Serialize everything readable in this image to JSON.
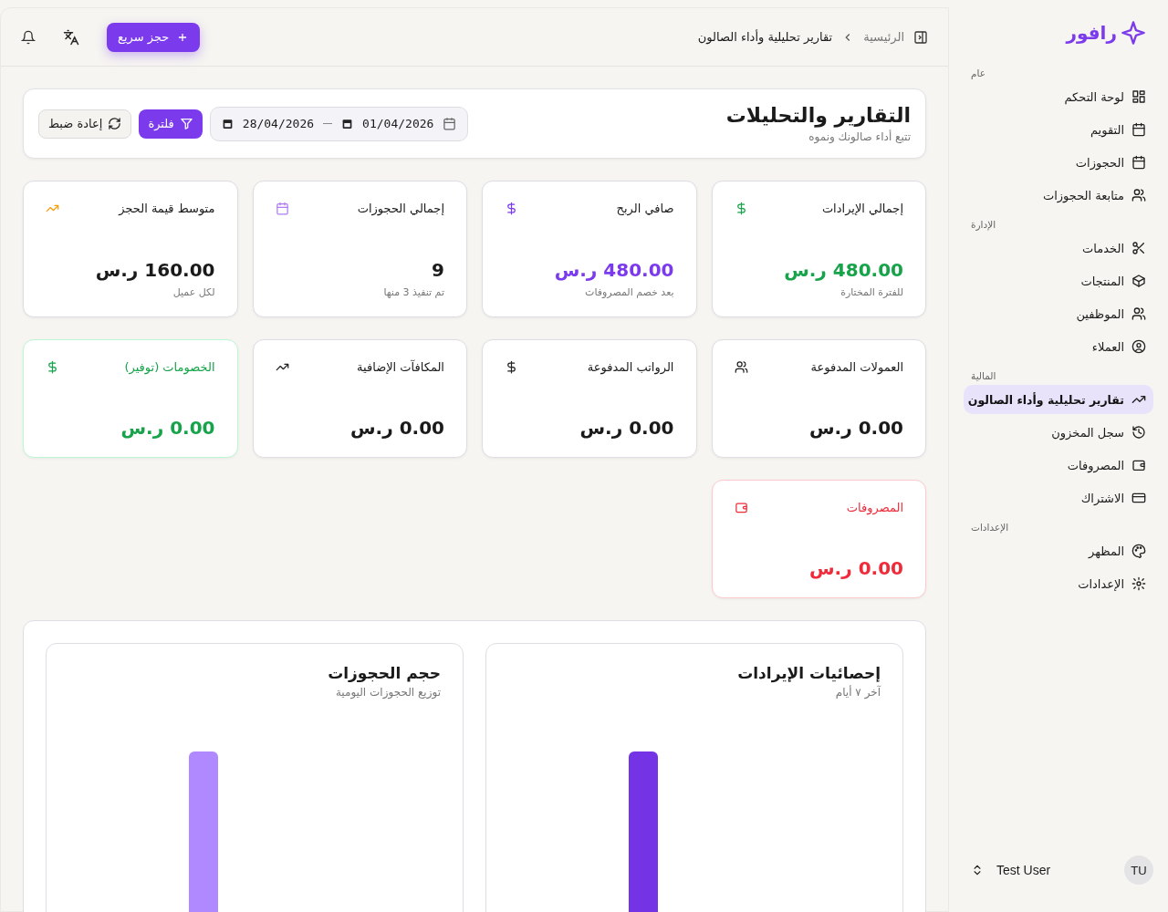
{
  "sidebar": {
    "logo": "رافور",
    "sections": [
      {
        "title": "عام",
        "items": [
          {
            "label": "لوحة التحكم",
            "selected": false
          },
          {
            "label": "التقويم",
            "selected": false
          },
          {
            "label": "الحجوزات",
            "selected": false
          },
          {
            "label": "متابعة الحجوزات",
            "selected": false
          }
        ]
      },
      {
        "title": "الإدارة",
        "items": [
          {
            "label": "الخدمات",
            "selected": false
          },
          {
            "label": "المنتجات",
            "selected": false
          },
          {
            "label": "الموظفين",
            "selected": false
          },
          {
            "label": "العملاء",
            "selected": false
          }
        ]
      },
      {
        "title": "المالية",
        "items": [
          {
            "label": "تقارير تحليلية وأداء الصالون",
            "selected": true
          },
          {
            "label": "سجل المخزون",
            "selected": false
          },
          {
            "label": "المصروفات",
            "selected": false
          },
          {
            "label": "الاشتراك",
            "selected": false
          }
        ]
      },
      {
        "title": "الإعدادات",
        "items": [
          {
            "label": "المظهر",
            "selected": false
          },
          {
            "label": "الإعدادات",
            "selected": false
          }
        ]
      }
    ],
    "user": {
      "initials": "TU",
      "name": "Test User"
    }
  },
  "topbar": {
    "breadcrumb": [
      "الرئيسية",
      "تقارير تحليلية وأداء الصالون"
    ],
    "quick_button": "حجز سريع"
  },
  "header": {
    "title": "التقارير والتحليلات",
    "subtitle": "تتبع أداء صالونك ونموه",
    "date_from": "01/04/2026",
    "date_to": "28/04/2026",
    "filter_button": "فلترة",
    "reset_button": "إعادة ضبط"
  },
  "stats": [
    {
      "label": "إجمالي الإيرادات",
      "value": "480.00 ر.س",
      "note": "للفترة المختارة",
      "kind": "positive"
    },
    {
      "label": "صافي الربح",
      "value": "480.00 ر.س",
      "note": "بعد خصم المصروفات",
      "kind": "accent"
    },
    {
      "label": "إجمالي الحجوزات",
      "value": "9",
      "note": "تم تنفيذ 3 منها",
      "kind": "plain"
    },
    {
      "label": "متوسط قيمة الحجز",
      "value": "160.00 ر.س",
      "note": "لكل عميل",
      "kind": "plain"
    },
    {
      "label": "العمولات المدفوعة",
      "value": "0.00 ر.س",
      "kind": "plain"
    },
    {
      "label": "الرواتب المدفوعة",
      "value": "0.00 ر.س",
      "kind": "plain"
    },
    {
      "label": "المكافآت الإضافية",
      "value": "0.00 ر.س",
      "kind": "plain"
    },
    {
      "label": "الخصومات (توفير)",
      "value": "0.00 ر.س",
      "kind": "saving"
    },
    {
      "label": "المصروفات",
      "value": "0.00 ر.س",
      "kind": "negative"
    }
  ],
  "charts": [
    {
      "title": "إحصائيات الإيرادات",
      "subtitle": "آخر ٧ أيام",
      "kind": "dark"
    },
    {
      "title": "حجم الحجوزات",
      "subtitle": "توزيع الحجوزات اليومية",
      "kind": "light"
    }
  ]
}
